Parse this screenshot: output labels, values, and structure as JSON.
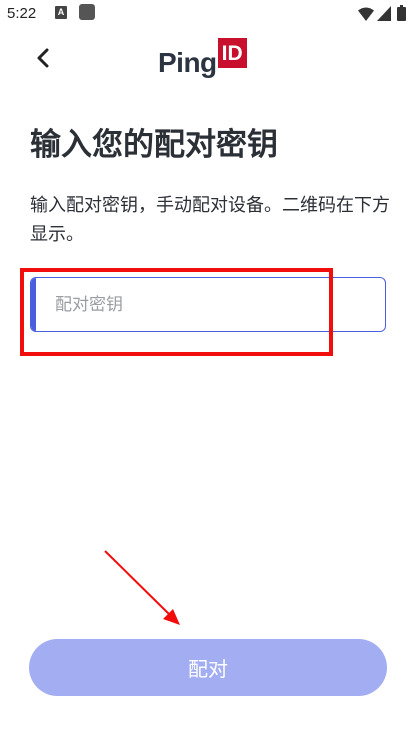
{
  "status_bar": {
    "time": "5:22",
    "notification_icon_label": "A"
  },
  "header": {
    "logo_text": "Ping",
    "logo_badge": "ID"
  },
  "main": {
    "title": "输入您的配对密钥",
    "description": "输入配对密钥，手动配对设备。二维码在下方显示。",
    "pairing_key_input": {
      "value": "",
      "placeholder": "配对密钥"
    },
    "pair_button_label": "配对"
  },
  "colors": {
    "accent": "#4a5ee0",
    "button_disabled": "#a3aef2",
    "logo_badge": "#c8102e",
    "annotation": "#f20d0d"
  },
  "icons": {
    "back": "arrow-back-icon",
    "wifi": "wifi-icon",
    "signal": "signal-icon",
    "battery": "battery-icon"
  }
}
